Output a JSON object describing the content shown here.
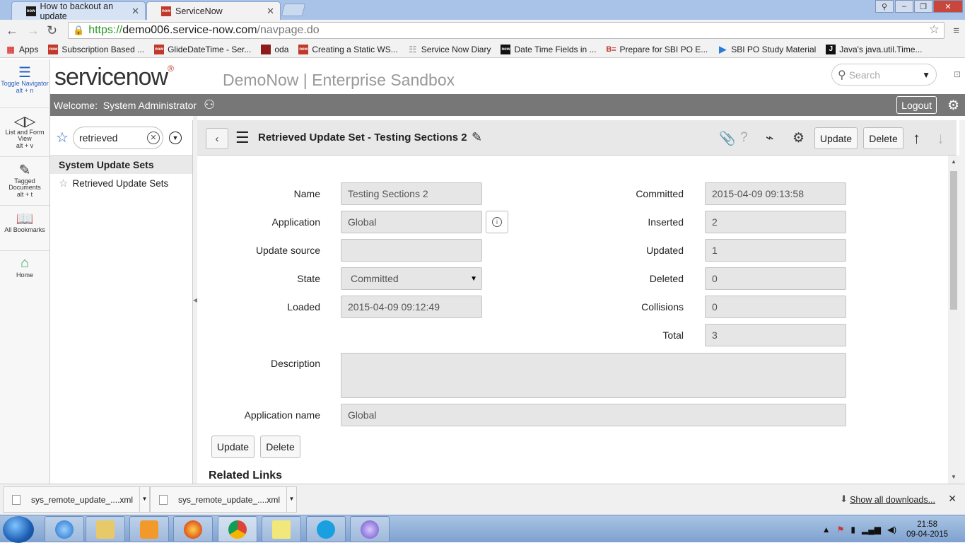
{
  "browser": {
    "tabs": [
      {
        "label": "How to backout an update",
        "favicon": "now"
      },
      {
        "label": "ServiceNow",
        "favicon": "now"
      }
    ],
    "url": {
      "scheme": "https://",
      "host": "demo006.service-now.com",
      "path": "/navpage.do"
    },
    "bookmarks": [
      {
        "label": "Apps",
        "icon": "apps-grid-icon",
        "color": "#d44"
      },
      {
        "label": "Subscription Based ...",
        "icon": "now",
        "color": "#c0392b"
      },
      {
        "label": "GlideDateTime - Ser...",
        "icon": "now",
        "color": "#c0392b"
      },
      {
        "label": "oda",
        "icon": "oda",
        "color": "#8e1b1b"
      },
      {
        "label": "Creating a Static WS...",
        "icon": "now",
        "color": "#c0392b"
      },
      {
        "label": "Service Now Diary",
        "icon": "page",
        "color": "#bbb"
      },
      {
        "label": "Date Time Fields in ...",
        "icon": "now",
        "color": "#111"
      },
      {
        "label": "Prepare for SBI PO E...",
        "icon": "be",
        "color": "#fff"
      },
      {
        "label": "SBI PO Study Material",
        "icon": "triangle",
        "color": "#2b7bd6"
      },
      {
        "label": "Java's java.util.Time...",
        "icon": "j",
        "color": "#111"
      }
    ]
  },
  "leftnav": [
    {
      "label": "Toggle Navigator",
      "sub": "alt + n",
      "icon": "list-icon"
    },
    {
      "label": "List and Form View",
      "sub": "alt + v",
      "icon": "split-view-icon"
    },
    {
      "label": "Tagged Documents",
      "sub": "alt + t",
      "icon": "tag-icon"
    },
    {
      "label": "All Bookmarks",
      "sub": "",
      "icon": "book-icon"
    },
    {
      "label": "Home",
      "sub": "",
      "icon": "home-icon"
    }
  ],
  "header": {
    "logo": "servicenow",
    "instance": "DemoNow | Enterprise Sandbox",
    "search_placeholder": "Search",
    "welcome_label": "Welcome:",
    "user": "System Administrator",
    "logout": "Logout"
  },
  "filter": {
    "value": "retrieved",
    "group": "System Update Sets",
    "modules": [
      "Retrieved Update Sets"
    ]
  },
  "form": {
    "title": "Retrieved Update Set - Testing Sections 2",
    "update_label": "Update",
    "delete_label": "Delete",
    "fields_left": [
      {
        "label": "Name",
        "value": "Testing Sections 2"
      },
      {
        "label": "Application",
        "value": "Global"
      },
      {
        "label": "Update source",
        "value": ""
      },
      {
        "label": "State",
        "value": "Committed"
      },
      {
        "label": "Loaded",
        "value": "2015-04-09 09:12:49"
      }
    ],
    "fields_right": [
      {
        "label": "Committed",
        "value": "2015-04-09 09:13:58"
      },
      {
        "label": "Inserted",
        "value": "2"
      },
      {
        "label": "Updated",
        "value": "1"
      },
      {
        "label": "Deleted",
        "value": "0"
      },
      {
        "label": "Collisions",
        "value": "0"
      },
      {
        "label": "Total",
        "value": "3"
      }
    ],
    "description_label": "Description",
    "description_value": "",
    "app_name_label": "Application name",
    "app_name_value": "Global",
    "related_links": "Related Links"
  },
  "downloads": {
    "items": [
      "sys_remote_update_....xml",
      "sys_remote_update_....xml"
    ],
    "show_all": "Show all downloads..."
  },
  "taskbar": {
    "time": "21:58",
    "date": "09-04-2015"
  }
}
